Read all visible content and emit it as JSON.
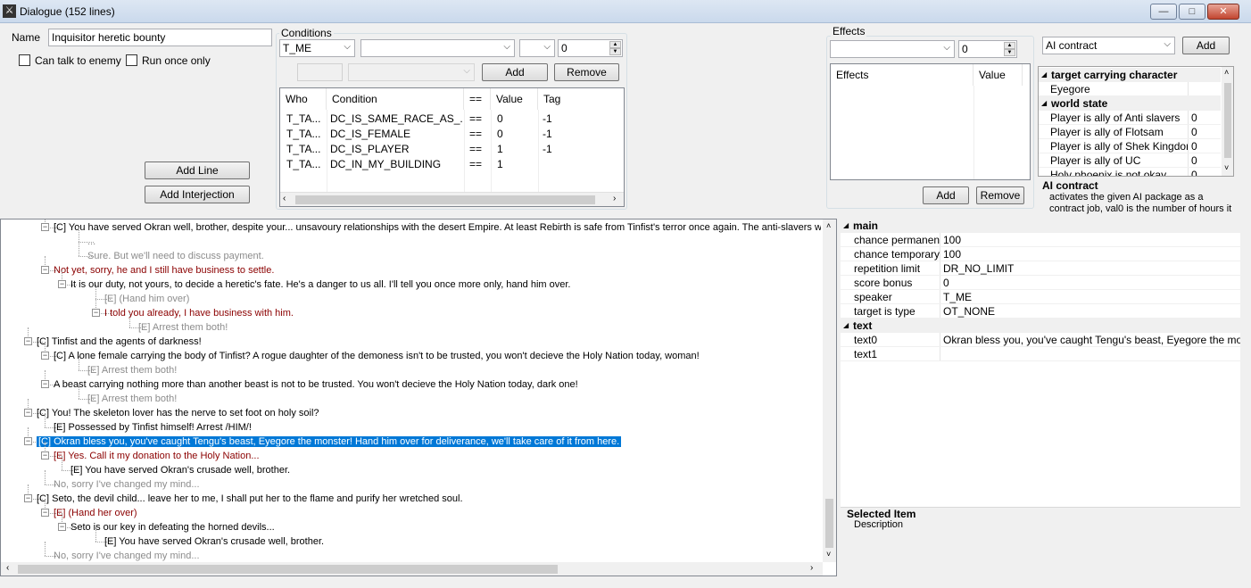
{
  "window": {
    "title": "Dialogue (152 lines)",
    "min": "—",
    "max": "□",
    "close": "✕"
  },
  "top": {
    "name_label": "Name",
    "name_value": "Inquisitor heretic bounty",
    "can_talk_enemy": "Can talk to enemy",
    "run_once": "Run once only",
    "add_line": "Add Line",
    "add_interjection": "Add Interjection"
  },
  "conditions": {
    "title": "Conditions",
    "who_value": "T_ME",
    "cond_value": "",
    "op_value": "",
    "num_value": "0",
    "add": "Add",
    "remove": "Remove",
    "columns": [
      "Who",
      "Condition",
      "==",
      "Value",
      "Tag"
    ],
    "rows": [
      [
        "T_TA...",
        "DC_IS_SAME_RACE_AS_...",
        "==",
        "0",
        "-1"
      ],
      [
        "T_TA...",
        "DC_IS_FEMALE",
        "==",
        "0",
        "-1"
      ],
      [
        "T_TA...",
        "DC_IS_PLAYER",
        "==",
        "1",
        "-1"
      ],
      [
        "T_TA...",
        "DC_IN_MY_BUILDING",
        "==",
        "1",
        ""
      ]
    ]
  },
  "effects": {
    "title": "Effects",
    "num_value": "0",
    "columns": [
      "Effects",
      "Value"
    ],
    "add": "Add",
    "remove": "Remove"
  },
  "ai": {
    "combo_value": "AI contract",
    "add": "Add",
    "groups": [
      {
        "name": "target carrying character",
        "rows": [
          [
            "Eyegore",
            ""
          ]
        ]
      },
      {
        "name": "world state",
        "rows": [
          [
            "Player is ally of Anti slavers",
            "0"
          ],
          [
            "Player is ally of Flotsam",
            "0"
          ],
          [
            "Player is ally of Shek Kingdom",
            "0"
          ],
          [
            "Player is ally of UC",
            "0"
          ],
          [
            "Holy phoenix is not okay",
            "0"
          ]
        ]
      }
    ],
    "help_title": "AI contract",
    "help_text": "activates the given AI package as a contract job, val0 is the number of hours it"
  },
  "tree": {
    "nodes": [
      {
        "text": "[C] You have served Okran well, brother, despite your... unsavoury relationships with the desert Empire. At least Rebirth is safe from Tinfist's terror once again. The anti-slavers will be",
        "style": "npc"
      },
      {
        "text": "...",
        "style": "grey"
      },
      {
        "text": "Sure. But we'll need to discuss payment.",
        "style": "grey"
      },
      {
        "text": "Not yet, sorry, he and I still have business to settle.",
        "style": "player"
      },
      {
        "text": "It is our duty, not yours, to decide a heretic's fate. He's a danger to us all. I'll tell you once more only, hand him over.",
        "style": "npc"
      },
      {
        "text": "[E] (Hand him over)",
        "style": "grey"
      },
      {
        "text": "I told you already, I have business with him.",
        "style": "player"
      },
      {
        "text": "[E] Arrest them both!",
        "style": "grey"
      },
      {
        "text": "[C] Tinfist and the agents of darkness!",
        "style": "npc"
      },
      {
        "text": "[C] A lone female carrying the body of Tinfist? A rogue daughter of the demoness isn't to be trusted, you won't decieve the Holy Nation today, woman!",
        "style": "npc"
      },
      {
        "text": "[E] Arrest them both!",
        "style": "grey"
      },
      {
        "text": "A beast carrying nothing more than another beast is not to be trusted. You won't decieve the Holy Nation today, dark one!",
        "style": "npc"
      },
      {
        "text": "[E] Arrest them both!",
        "style": "grey"
      },
      {
        "text": "[C] You! The skeleton lover has the nerve to set foot on holy soil?",
        "style": "npc"
      },
      {
        "text": "[E] Possessed by Tinfist himself! Arrest /HIM/!",
        "style": "npc"
      },
      {
        "text": "[C] Okran bless you, you've caught Tengu's beast, Eyegore the monster! Hand him over for deliverance, we'll take care of it from here.",
        "style": "sel"
      },
      {
        "text": "[E] Yes. Call it my donation to the Holy Nation...",
        "style": "player"
      },
      {
        "text": "[E] You have served Okran's crusade well, brother.",
        "style": "npc"
      },
      {
        "text": "No, sorry I've changed my mind...",
        "style": "grey"
      },
      {
        "text": "[C] Seto, the devil child... leave her to me, I shall put her to the flame and purify her wretched soul.",
        "style": "npc"
      },
      {
        "text": "[E] (Hand her over)",
        "style": "player"
      },
      {
        "text": "Seto is our key in defeating the horned devils...",
        "style": "npc"
      },
      {
        "text": "[E] You have served Okran's crusade well, brother.",
        "style": "npc"
      },
      {
        "text": "No, sorry I've changed my mind...",
        "style": "grey"
      }
    ]
  },
  "props": {
    "groups": [
      {
        "name": "main",
        "rows": [
          [
            "chance permanent",
            "100"
          ],
          [
            "chance temporary",
            "100"
          ],
          [
            "repetition limit",
            "DR_NO_LIMIT"
          ],
          [
            "score bonus",
            "0"
          ],
          [
            "speaker",
            "T_ME"
          ],
          [
            "target is type",
            "OT_NONE"
          ]
        ]
      },
      {
        "name": "text",
        "rows": [
          [
            "text0",
            "Okran bless you, you've caught Tengu's beast, Eyegore the monster! H"
          ],
          [
            "text1",
            ""
          ]
        ]
      }
    ],
    "selected_title": "Selected Item",
    "selected_desc": "Description"
  }
}
